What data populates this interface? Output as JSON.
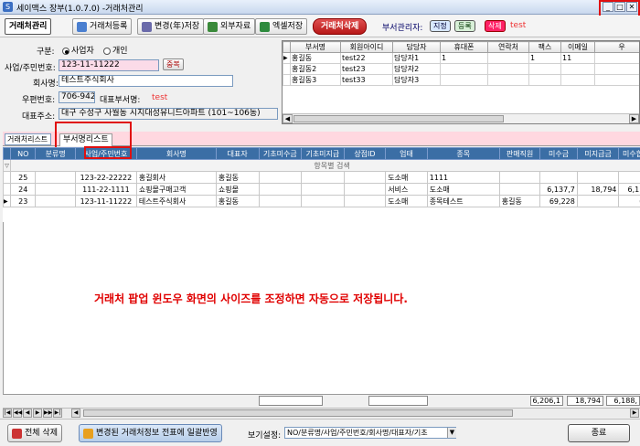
{
  "window": {
    "title": "세이맥스 장부(1.0.7.0) -거래처관리",
    "min": "_",
    "max": "□",
    "close": "✕"
  },
  "toolbar": {
    "tabs": [
      "거래처관리",
      "거래처등록",
      "변경(年)저장",
      "외부자료",
      "엑셀저장"
    ],
    "delete_label": "거래처삭제",
    "dept_manager_label": "부서관리자:",
    "designate_label": "지정",
    "register_label": "등록",
    "delete_small_label": "삭제",
    "manager_value": "test"
  },
  "form": {
    "type_label": "구분:",
    "type_options": [
      "사업자",
      "개인"
    ],
    "bizno_label": "사업/주민번호:",
    "bizno_value": "123-11-11222",
    "dup_button": "중복",
    "company_label": "회사명:",
    "company_value": "테스트주식회사",
    "postcode_label": "우편번호:",
    "postcode_value": "706-942",
    "rep_dept_label": "대표부서명:",
    "rep_dept_value": "test",
    "address_label": "대표주소:",
    "address_value": "대구 수성구 사월동 시지대성유니드아파트 (101~106동)"
  },
  "dept_grid": {
    "columns": [
      "부서명",
      "회원아이디",
      "담당자",
      "휴대폰",
      "연락처",
      "팩스",
      "이메일",
      "우"
    ],
    "rows": [
      [
        "홍길동",
        "test22",
        "담당자1",
        "1",
        "",
        "1",
        "11",
        ""
      ],
      [
        "홍길동2",
        "test23",
        "담당자2",
        "",
        "",
        "",
        "",
        ""
      ],
      [
        "홍길동3",
        "test33",
        "담당자3",
        "",
        "",
        "",
        "",
        ""
      ]
    ]
  },
  "tabs": [
    "거래처리스트",
    "부서명리스트"
  ],
  "main_grid": {
    "columns": [
      "NO",
      "분류명",
      "사업/주민번호",
      "회사명",
      "대표자",
      "기초미수금",
      "기초미지급",
      "상점ID",
      "업태",
      "종목",
      "판매직원",
      "미수금",
      "미지급금",
      "미수합계"
    ],
    "group_row": "항목별 검색",
    "rows": [
      [
        "25",
        "",
        "123-22-22222",
        "홍길회사",
        "홍길동",
        "",
        "",
        "",
        "도소매",
        "1111",
        "",
        "",
        "",
        ""
      ],
      [
        "24",
        "",
        "111-22-1111",
        "쇼핑몰구매고객",
        "쇼핑몰",
        "",
        "",
        "",
        "서비스",
        "도소매",
        "",
        "6,137,7",
        "18,794",
        "6,118,"
      ],
      [
        "23",
        "",
        "123-11-11222",
        "테스트주식회사",
        "홍길동",
        "",
        "",
        "",
        "도소매",
        "종목테스트",
        "홍길동",
        "69,228",
        "",
        "69,"
      ]
    ]
  },
  "notice": "거래처 팝업 윈도우 화면의 사이즈를 조정하면 자동으로 저장됩니다.",
  "summary": [
    "6,206,1",
    "18,794",
    "6,188,"
  ],
  "bottom": {
    "delete_all": "전체 삭제",
    "apply": "변경된 거래처정보 전표에 일괄반영",
    "view_label": "보기설정:",
    "view_value": "NO/분류명/사업/주민번호/회사명/대표자/기초",
    "close": "종료"
  }
}
